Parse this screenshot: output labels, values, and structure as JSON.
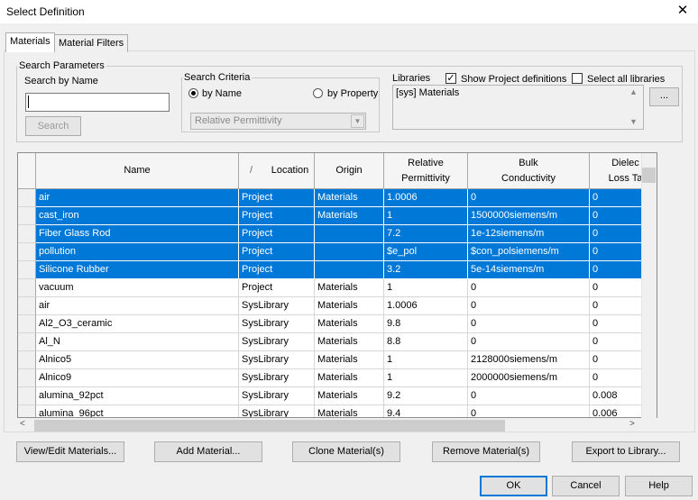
{
  "window": {
    "title": "Select Definition",
    "close_glyph": "✕"
  },
  "tabs": [
    {
      "label": "Materials",
      "active": true
    },
    {
      "label": "Material Filters",
      "active": false
    }
  ],
  "search_params": {
    "legend": "Search Parameters",
    "search_by_name_label": "Search by Name",
    "name_value": "",
    "search_button": "Search"
  },
  "search_criteria": {
    "legend": "Search Criteria",
    "by_name": "by Name",
    "by_property": "by Property",
    "selected": "by Name",
    "property_value": "Relative Permittivity"
  },
  "libraries": {
    "label": "Libraries",
    "show_project_defs": {
      "label": "Show Project definitions",
      "checked": true
    },
    "select_all": {
      "label": "Select all libraries",
      "checked": false
    },
    "items": [
      "[sys] Materials"
    ],
    "more_button": "..."
  },
  "table": {
    "columns": [
      {
        "key": "name",
        "label": "Name"
      },
      {
        "key": "location",
        "label": "Location",
        "sort_indicator": "/"
      },
      {
        "key": "origin",
        "label": "Origin"
      },
      {
        "key": "perm",
        "label": "Relative\nPermittivity"
      },
      {
        "key": "cond",
        "label": "Bulk\nConductivity"
      },
      {
        "key": "loss",
        "label": "Dielec\nLoss Ta"
      }
    ],
    "rows": [
      {
        "name": "air",
        "location": "Project",
        "origin": "Materials",
        "perm": "1.0006",
        "cond": "0",
        "loss": "0",
        "selected": true
      },
      {
        "name": "cast_iron",
        "location": "Project",
        "origin": "Materials",
        "perm": "1",
        "cond": "1500000siemens/m",
        "loss": "0",
        "selected": true
      },
      {
        "name": "Fiber Glass Rod",
        "location": "Project",
        "origin": "",
        "perm": "7.2",
        "cond": "1e-12siemens/m",
        "loss": "0",
        "selected": true
      },
      {
        "name": "pollution",
        "location": "Project",
        "origin": "",
        "perm": "$e_pol",
        "cond": "$con_polsiemens/m",
        "loss": "0",
        "selected": true
      },
      {
        "name": "Silicone Rubber",
        "location": "Project",
        "origin": "",
        "perm": "3.2",
        "cond": "5e-14siemens/m",
        "loss": "0",
        "selected": true
      },
      {
        "name": "vacuum",
        "location": "Project",
        "origin": "Materials",
        "perm": "1",
        "cond": "0",
        "loss": "0",
        "selected": false
      },
      {
        "name": "air",
        "location": "SysLibrary",
        "origin": "Materials",
        "perm": "1.0006",
        "cond": "0",
        "loss": "0",
        "selected": false
      },
      {
        "name": "Al2_O3_ceramic",
        "location": "SysLibrary",
        "origin": "Materials",
        "perm": "9.8",
        "cond": "0",
        "loss": "0",
        "selected": false
      },
      {
        "name": "Al_N",
        "location": "SysLibrary",
        "origin": "Materials",
        "perm": "8.8",
        "cond": "0",
        "loss": "0",
        "selected": false
      },
      {
        "name": "Alnico5",
        "location": "SysLibrary",
        "origin": "Materials",
        "perm": "1",
        "cond": "2128000siemens/m",
        "loss": "0",
        "selected": false
      },
      {
        "name": "Alnico9",
        "location": "SysLibrary",
        "origin": "Materials",
        "perm": "1",
        "cond": "2000000siemens/m",
        "loss": "0",
        "selected": false
      },
      {
        "name": "alumina_92pct",
        "location": "SysLibrary",
        "origin": "Materials",
        "perm": "9.2",
        "cond": "0",
        "loss": "0.008",
        "selected": false
      },
      {
        "name": "alumina_96pct",
        "location": "SysLibrary",
        "origin": "Materials",
        "perm": "9.4",
        "cond": "0",
        "loss": "0.006",
        "selected": false
      }
    ]
  },
  "actions": {
    "view_edit": "View/Edit Materials...",
    "add": "Add Material...",
    "clone": "Clone Material(s)",
    "remove": "Remove Material(s)",
    "export": "Export to Library..."
  },
  "footer": {
    "ok": "OK",
    "cancel": "Cancel",
    "help": "Help"
  },
  "colors": {
    "selection": "#0078d7",
    "default_button_border": "#0078d7"
  }
}
